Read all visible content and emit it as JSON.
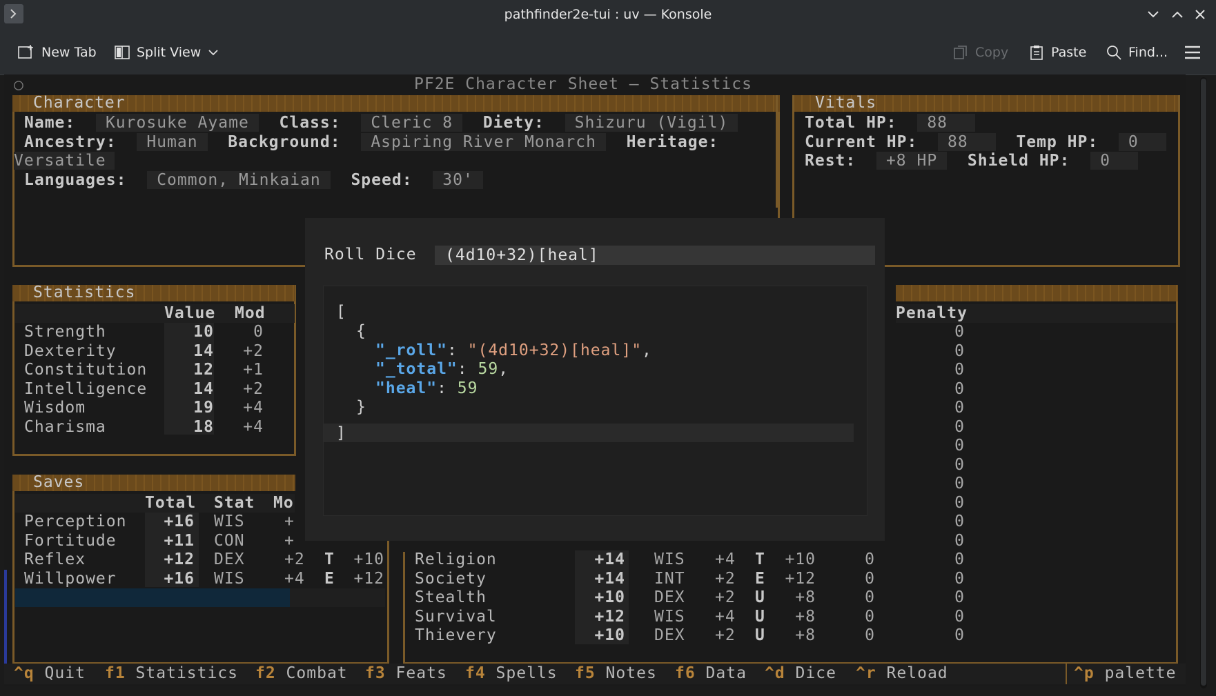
{
  "window": {
    "title": "pathfinder2e-tui : uv — Konsole"
  },
  "toolbar": {
    "new_tab": "New Tab",
    "split_view": "Split View",
    "copy": "Copy",
    "paste": "Paste",
    "find": "Find..."
  },
  "app": {
    "title": "PF2E Character Sheet — Statistics",
    "indicator": "○"
  },
  "character": {
    "header": "Character",
    "name_label": "Name:",
    "name": "Kurosuke Ayame",
    "class_label": "Class:",
    "class": "Cleric 8",
    "diety_label": "Diety:",
    "diety": "Shizuru (Vigil)",
    "ancestry_label": "Ancestry:",
    "ancestry": "Human",
    "background_label": "Background:",
    "background": "Aspiring River Monarch",
    "heritage_label": "Heritage:",
    "heritage": "Versatile",
    "languages_label": "Languages:",
    "languages": "Common, Minkaian",
    "speed_label": "Speed:",
    "speed": "30'"
  },
  "vitals": {
    "header": "Vitals",
    "total_hp_label": "Total HP:",
    "total_hp": "88",
    "current_hp_label": "Current HP:",
    "current_hp": "88",
    "temp_hp_label": "Temp HP:",
    "temp_hp": "0",
    "rest_label": "Rest:",
    "rest": "+8 HP",
    "shield_hp_label": "Shield HP:",
    "shield_hp": "0"
  },
  "statistics": {
    "header": "Statistics",
    "col_value": "Value",
    "col_mod": "Mod",
    "rows": [
      {
        "name": "Strength",
        "value": "10",
        "mod": "0"
      },
      {
        "name": "Dexterity",
        "value": "14",
        "mod": "+2"
      },
      {
        "name": "Constitution",
        "value": "12",
        "mod": "+1"
      },
      {
        "name": "Intelligence",
        "value": "14",
        "mod": "+2"
      },
      {
        "name": "Wisdom",
        "value": "19",
        "mod": "+4"
      },
      {
        "name": "Charisma",
        "value": "18",
        "mod": "+4"
      }
    ]
  },
  "saves": {
    "header": "Saves",
    "col_total": "Total",
    "col_stat": "Stat",
    "col_mod": "Mo",
    "rows": [
      {
        "name": "Perception",
        "total": "+16",
        "stat": "WIS",
        "mod": "+",
        "prof": "",
        "prof_val": ""
      },
      {
        "name": "Fortitude",
        "total": "+11",
        "stat": "CON",
        "mod": "+",
        "prof": "",
        "prof_val": ""
      },
      {
        "name": "Reflex",
        "total": "+12",
        "stat": "DEX",
        "mod": "+2",
        "prof": "T",
        "prof_val": "+10"
      },
      {
        "name": "Willpower",
        "total": "+16",
        "stat": "WIS",
        "mod": "+4",
        "prof": "E",
        "prof_val": "+12"
      }
    ]
  },
  "skills": {
    "col_penalty": "Penalty",
    "penalties": [
      "0",
      "0",
      "0",
      "0",
      "0",
      "0",
      "0",
      "0",
      "0",
      "0",
      "0",
      "0"
    ],
    "rows": [
      {
        "name": "Religion",
        "total": "+14",
        "stat": "WIS",
        "mod": "+4",
        "prof": "T",
        "prof_val": "+10",
        "item": "0",
        "penalty": "0"
      },
      {
        "name": "Society",
        "total": "+14",
        "stat": "INT",
        "mod": "+2",
        "prof": "E",
        "prof_val": "+12",
        "item": "0",
        "penalty": "0"
      },
      {
        "name": "Stealth",
        "total": "+10",
        "stat": "DEX",
        "mod": "+2",
        "prof": "U",
        "prof_val": "+8",
        "item": "0",
        "penalty": "0"
      },
      {
        "name": "Survival",
        "total": "+12",
        "stat": "WIS",
        "mod": "+4",
        "prof": "U",
        "prof_val": "+8",
        "item": "0",
        "penalty": "0"
      },
      {
        "name": "Thievery",
        "total": "+10",
        "stat": "DEX",
        "mod": "+2",
        "prof": "U",
        "prof_val": "+8",
        "item": "0",
        "penalty": "0"
      }
    ]
  },
  "dice_modal": {
    "label": "Roll Dice",
    "input_value": "(4d10+32)[heal]",
    "json": {
      "open_bracket": "[",
      "open_brace": "{",
      "roll_key": "\"_roll\"",
      "roll_value": "\"(4d10+32)[heal]\"",
      "total_key": "\"_total\"",
      "total_value": "59",
      "heal_key": "\"heal\"",
      "heal_value": "59",
      "close_brace": "}",
      "close_bracket": "]"
    }
  },
  "footer": {
    "keys": [
      {
        "key": "^q",
        "label": "Quit"
      },
      {
        "key": "f1",
        "label": "Statistics"
      },
      {
        "key": "f2",
        "label": "Combat"
      },
      {
        "key": "f3",
        "label": "Feats"
      },
      {
        "key": "f4",
        "label": "Spells"
      },
      {
        "key": "f5",
        "label": "Notes"
      },
      {
        "key": "f6",
        "label": "Data"
      },
      {
        "key": "^d",
        "label": "Dice"
      },
      {
        "key": "^r",
        "label": "Reload"
      }
    ],
    "palette_key": "^p",
    "palette_label": "palette"
  },
  "colors": {
    "panel_border": "#7a5a28",
    "footer_key": "#b8843a",
    "json_key": "#5aa7e8",
    "json_string": "#e0a080",
    "json_number": "#b8d8a0"
  }
}
